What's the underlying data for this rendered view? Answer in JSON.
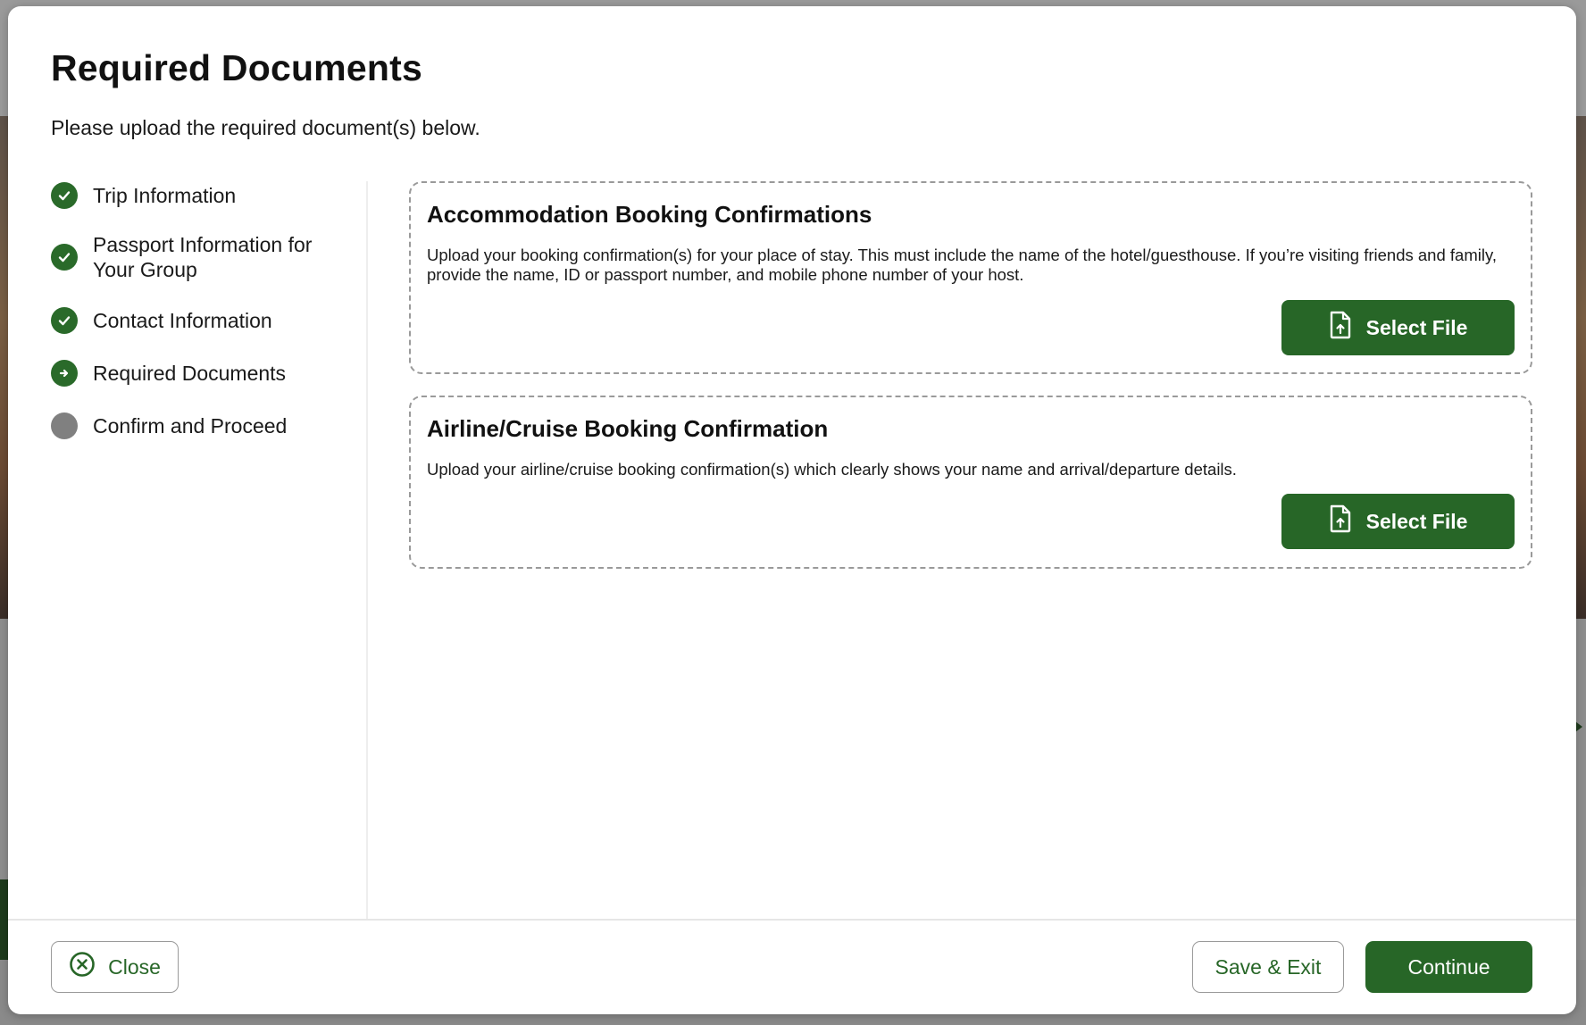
{
  "modal": {
    "title": "Required Documents",
    "subtitle": "Please upload the required document(s) below."
  },
  "stepper": {
    "steps": [
      {
        "label": "Trip Information",
        "status": "complete",
        "icon": "check-circle-icon"
      },
      {
        "label": "Passport Information for Your Group",
        "status": "complete",
        "icon": "check-circle-icon"
      },
      {
        "label": "Contact Information",
        "status": "complete",
        "icon": "check-circle-icon"
      },
      {
        "label": "Required Documents",
        "status": "current",
        "icon": "arrow-right-circle-icon"
      },
      {
        "label": "Confirm and Proceed",
        "status": "pending",
        "icon": "grey-dot-icon"
      }
    ]
  },
  "documents": [
    {
      "title": "Accommodation Booking Confirmations",
      "description": "Upload your booking confirmation(s) for your place of stay. This must include the name of the hotel/guesthouse. If you’re visiting friends and family, provide the name, ID or passport number, and mobile phone number of your host.",
      "button_label": "Select File",
      "button_icon": "file-upload-icon"
    },
    {
      "title": "Airline/Cruise Booking Confirmation",
      "description": "Upload your airline/cruise booking confirmation(s) which clearly shows your name and arrival/departure details.",
      "button_label": "Select File",
      "button_icon": "file-upload-icon"
    }
  ],
  "footer": {
    "close_label": "Close",
    "close_icon": "circle-x-icon",
    "save_exit_label": "Save & Exit",
    "continue_label": "Continue"
  },
  "colors": {
    "primary": "#276627",
    "step_complete": "#2a6a2a",
    "step_pending": "#808080",
    "border": "#9a9a9a"
  }
}
